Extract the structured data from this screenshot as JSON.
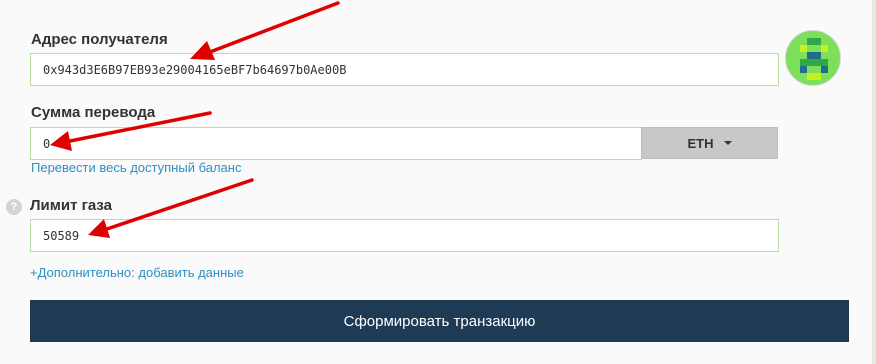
{
  "form": {
    "address": {
      "label": "Адрес получателя",
      "value": "0x943d3E6B97EB93e29004165eBF7b64697b0Ae00B"
    },
    "amount": {
      "label": "Сумма перевода",
      "value": "0",
      "unit": "ETH",
      "send_all_link": "Перевести весь доступный баланс"
    },
    "gas": {
      "label": "Лимит газа",
      "value": "50589",
      "help_icon": "?"
    },
    "advanced_link": "+Дополнительно: добавить данные",
    "submit_label": "Сформировать транзакцию"
  },
  "colors": {
    "field_border": "#b8e0a2",
    "link": "#2f8fc0",
    "submit_bg": "#1e3a55",
    "arrow": "#e00000"
  },
  "icons": {
    "avatar": "identicon-avatar",
    "dropdown": "chevron-down-icon",
    "help": "question-circle-icon"
  }
}
